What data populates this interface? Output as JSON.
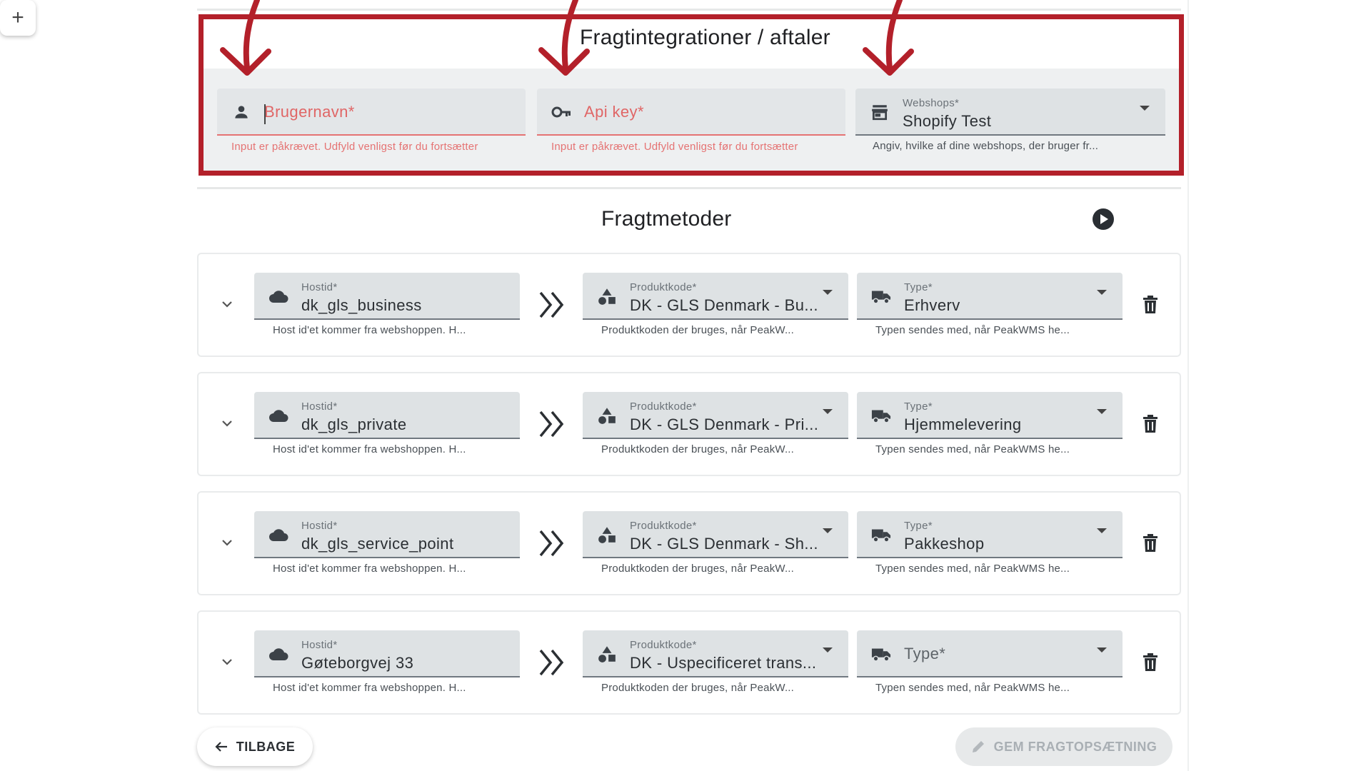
{
  "integration": {
    "title": "Fragtintegrationer / aftaler",
    "username": {
      "placeholder": "Brugernavn*",
      "error": "Input er påkrævet. Udfyld venligst før du fortsætter"
    },
    "apikey": {
      "placeholder": "Api key*",
      "error": "Input er påkrævet. Udfyld venligst før du fortsætter"
    },
    "webshop": {
      "label": "Webshops*",
      "value": "Shopify Test",
      "hint": "Angiv, hvilke af dine webshops, der bruger fr..."
    }
  },
  "methods": {
    "title": "Fragtmetoder",
    "add_label": "+",
    "labels": {
      "host": "Hostid*",
      "product": "Produktkode*",
      "type": "Type*"
    },
    "hints": {
      "host": "Host id'et kommer fra webshoppen. H...",
      "product": "Produktkoden der bruges, når PeakW...",
      "type": "Typen sendes med, når PeakWMS he..."
    },
    "rows": [
      {
        "host": "dk_gls_business",
        "product": "DK - GLS Denmark - Bu...",
        "type": "Erhverv"
      },
      {
        "host": "dk_gls_private",
        "product": "DK - GLS Denmark - Pri...",
        "type": "Hjemmelevering"
      },
      {
        "host": "dk_gls_service_point",
        "product": "DK - GLS Denmark - Sh...",
        "type": "Pakkeshop"
      },
      {
        "host": "Gøteborgvej 33",
        "product": "DK - Uspecificeret trans...",
        "type": ""
      }
    ]
  },
  "footer": {
    "back_label": "TILBAGE",
    "save_label": "GEM FRAGTOPSÆTNING"
  },
  "colors": {
    "annotation": "#b3202a",
    "error": "#e57373",
    "field_bg": "#dee2e4"
  },
  "icons": [
    "person-icon",
    "key-icon",
    "store-icon",
    "cloud-icon",
    "shapes-icon",
    "truck-icon",
    "trash-icon",
    "chevron-down-icon",
    "double-chevron-right-icon",
    "play-icon",
    "plus-icon",
    "arrow-left-icon",
    "pencil-icon",
    "curved-arrow-icon"
  ]
}
